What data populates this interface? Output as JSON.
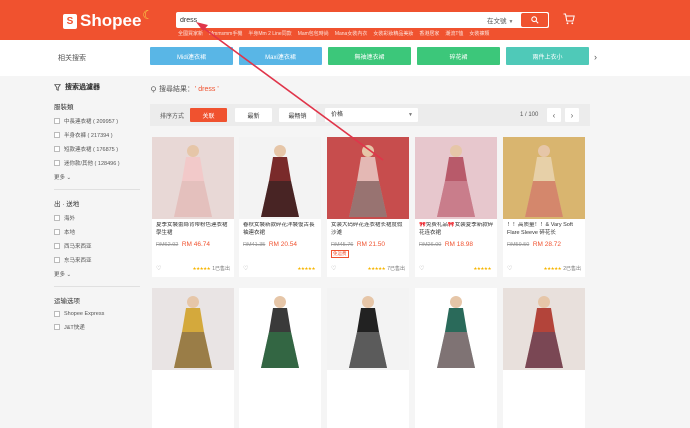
{
  "header": {
    "brand": "Shopee",
    "search_value": "dress",
    "search_scope": "在文號",
    "suggestions": [
      "全國買家新",
      "Mmmsmm手機",
      "半身Mm 2 Line同款",
      "Mam包包時尚",
      "Mana女裝內衣",
      "女裝彩妝精品美妝",
      "香港居家",
      "潮流T恤",
      "女裝褲類"
    ]
  },
  "categories": {
    "title": "相关搜索",
    "tiles": [
      {
        "label": "Midi連衣裙",
        "color": "#59b6e6"
      },
      {
        "label": "Maxi連衣裙",
        "color": "#59b6e6"
      },
      {
        "label": "無袖連衣裙",
        "color": "#3cc77a"
      },
      {
        "label": "碎花裙",
        "color": "#3cc77a"
      },
      {
        "label": "兩件上衣小",
        "color": "#4fc9b8"
      }
    ]
  },
  "sidebar": {
    "heading": "搜索過濾器",
    "section1_title": "服裝類",
    "category_options": [
      {
        "label": "中長連衣裙 ( 209957 )"
      },
      {
        "label": "半身衣褲 ( 217394 )"
      },
      {
        "label": "短款連衣裙 ( 176875 )"
      },
      {
        "label": "迷你款/其他 ( 128496 )"
      }
    ],
    "more_label": "更多",
    "section2_title": "出 · 送地",
    "location_options": [
      {
        "label": "海外"
      },
      {
        "label": "本地"
      },
      {
        "label": "西马来西亚"
      },
      {
        "label": "东马来西亚"
      }
    ],
    "more_label2": "更多",
    "section3_title": "运输选项",
    "shipping_options": [
      {
        "label": "Shopee Express"
      },
      {
        "label": "J&T快递"
      }
    ]
  },
  "results": {
    "prefix": "搜尋結果：",
    "keyword": "' dress '"
  },
  "sortbar": {
    "label": "排序方式",
    "buttons": [
      "关联",
      "最新",
      "最畅销"
    ],
    "price_label": "价格",
    "page": "1 / 100"
  },
  "products": [
    {
      "name": "夏季女裝蕾絲背帶粉色連衣裙學生裙",
      "old": "RM62.92",
      "price": "RM 46.74",
      "sold": "1已售出",
      "tag": "",
      "badge": "",
      "img": [
        "#e8d8d6",
        "#f2c9c9",
        "#d9b8b2"
      ]
    },
    {
      "name": "春秋女裝新款碎花洋裝復古長袖連衣裙",
      "old": "RM41.35",
      "price": "RM 20.54",
      "sold": "",
      "tag": "",
      "badge": "",
      "img": [
        "#f3f3f3",
        "#7a2a2a",
        "#1f1f1f"
      ]
    },
    {
      "name": "女装大码碎花连衣裙长裙度假沙滩",
      "old": "RM45.76",
      "price": "RM 21.50",
      "sold": "7已售出",
      "tag": "免运费",
      "badge": "",
      "img": [
        "#c74d4d",
        "#e4b8b4",
        "#5a3a3a"
      ]
    },
    {
      "name": "🎀免费礼品🎀女装夏季新款碎花连衣裙",
      "old": "RM26.00",
      "price": "RM 18.98",
      "sold": "",
      "tag": "",
      "badge": "",
      "img": [
        "#e7c7cd",
        "#b85a6a",
        "#d79aa6"
      ]
    },
    {
      "name": "！！高质量！！& Vary Soft Flare Sleeve 碎花长",
      "old": "RM59.50",
      "price": "RM 28.72",
      "sold": "2已售出",
      "tag": "",
      "badge": "",
      "img": [
        "#d9b56f",
        "#e7d0a8",
        "#c44a3a"
      ]
    },
    {
      "name": "",
      "old": "",
      "price": "",
      "sold": "",
      "tag": "",
      "badge": "",
      "img": [
        "#e9e4e4",
        "#d4a93c",
        "#6a5a50"
      ]
    },
    {
      "name": "",
      "old": "",
      "price": "",
      "sold": "",
      "tag": "",
      "badge": "",
      "img": [
        "#ffffff",
        "#3a3a3a",
        "#2d8a4a"
      ]
    },
    {
      "name": "",
      "old": "",
      "price": "",
      "sold": "",
      "tag": "",
      "badge": "",
      "img": [
        "#f3f3f3",
        "#222222",
        "#8a8a8a"
      ]
    },
    {
      "name": "",
      "old": "",
      "price": "",
      "sold": "",
      "tag": "",
      "badge": "",
      "img": [
        "#ffffff",
        "#2a6a5a",
        "#c47a8a"
      ]
    },
    {
      "name": "",
      "old": "",
      "price": "",
      "sold": "",
      "tag": "",
      "badge": "",
      "img": [
        "#e8e0dc",
        "#b3443a",
        "#4a4a6a"
      ]
    }
  ],
  "colors": {
    "brand": "#f0522f",
    "arrow": "#e0354a"
  }
}
